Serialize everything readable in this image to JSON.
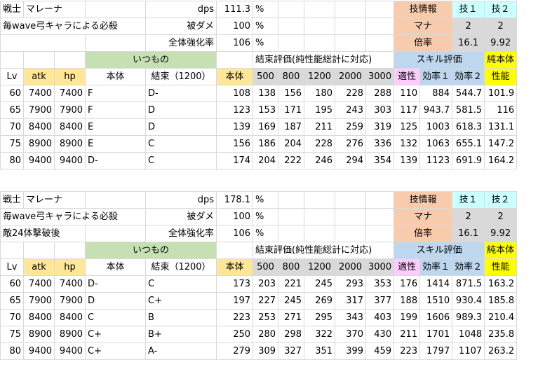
{
  "tables": [
    {
      "role": "戦士",
      "name": "マレーナ",
      "dps_label": "dps",
      "dps_value": "111.3",
      "pct": "%",
      "row2_label": "毎wave弓キャラによる必殺",
      "row3_label": "",
      "dmg_label": "被ダメ",
      "dmg_value": "100",
      "boost_label": "全体強化率",
      "boost_value": "106",
      "skill_info_label": "技情報",
      "skill1_label": "技１",
      "skill2_label": "技２",
      "mana_label": "マナ",
      "mana1": "2",
      "mana2": "2",
      "mult_label": "倍率",
      "mult1": "16.1",
      "mult2": "9.92",
      "group_itsumono": "いつもの",
      "group_kessoku": "結束評価(純性能総計に対応)",
      "group_skill": "スキル評価",
      "group_pure": "純本体",
      "headers": [
        "Lv",
        "atk",
        "hp",
        "本体",
        "結束（1200）",
        "本体",
        "500",
        "800",
        "1200",
        "2000",
        "3000",
        "適性",
        "効率１",
        "効率２",
        "性能"
      ],
      "rows": [
        [
          "60",
          "7400",
          "7400",
          "F",
          "D-",
          "108",
          "138",
          "156",
          "180",
          "228",
          "288",
          "110",
          "884",
          "544.7",
          "101.9"
        ],
        [
          "65",
          "7900",
          "7900",
          "F",
          "D",
          "123",
          "153",
          "171",
          "195",
          "243",
          "303",
          "117",
          "943.7",
          "581.5",
          "116"
        ],
        [
          "70",
          "8400",
          "8400",
          "E",
          "D",
          "139",
          "169",
          "187",
          "211",
          "259",
          "319",
          "125",
          "1003",
          "618.3",
          "131.1"
        ],
        [
          "75",
          "8900",
          "8900",
          "E",
          "C",
          "156",
          "186",
          "204",
          "228",
          "276",
          "336",
          "132",
          "1063",
          "655.1",
          "147.2"
        ],
        [
          "80",
          "9400",
          "9400",
          "D-",
          "C",
          "174",
          "204",
          "222",
          "246",
          "294",
          "354",
          "139",
          "1123",
          "691.9",
          "164.2"
        ]
      ]
    },
    {
      "role": "戦士",
      "name": "マレーナ",
      "dps_label": "dps",
      "dps_value": "178.1",
      "pct": "%",
      "row2_label": "毎wave弓キャラによる必殺",
      "row3_label": "敵24体撃破後",
      "dmg_label": "被ダメ",
      "dmg_value": "100",
      "boost_label": "全体強化率",
      "boost_value": "106",
      "skill_info_label": "技情報",
      "skill1_label": "技１",
      "skill2_label": "技２",
      "mana_label": "マナ",
      "mana1": "2",
      "mana2": "2",
      "mult_label": "倍率",
      "mult1": "16.1",
      "mult2": "9.92",
      "group_itsumono": "いつもの",
      "group_kessoku": "結束評価(純性能総計に対応)",
      "group_skill": "スキル評価",
      "group_pure": "純本体",
      "headers": [
        "Lv",
        "atk",
        "hp",
        "本体",
        "結束（1200）",
        "本体",
        "500",
        "800",
        "1200",
        "2000",
        "3000",
        "適性",
        "効率１",
        "効率２",
        "性能"
      ],
      "rows": [
        [
          "60",
          "7400",
          "7400",
          "D-",
          "C",
          "173",
          "203",
          "221",
          "245",
          "293",
          "353",
          "176",
          "1414",
          "871.5",
          "163.2"
        ],
        [
          "65",
          "7900",
          "7900",
          "D",
          "C+",
          "197",
          "227",
          "245",
          "269",
          "317",
          "377",
          "188",
          "1510",
          "930.4",
          "185.8"
        ],
        [
          "70",
          "8400",
          "8400",
          "C",
          "B",
          "223",
          "253",
          "271",
          "295",
          "343",
          "403",
          "199",
          "1606",
          "989.3",
          "210.4"
        ],
        [
          "75",
          "8900",
          "8900",
          "C+",
          "B+",
          "250",
          "280",
          "298",
          "322",
          "370",
          "430",
          "211",
          "1701",
          "1048",
          "235.8"
        ],
        [
          "80",
          "9400",
          "9400",
          "C+",
          "A-",
          "279",
          "309",
          "327",
          "351",
          "399",
          "459",
          "223",
          "1797",
          "1107",
          "263.2"
        ]
      ]
    }
  ]
}
